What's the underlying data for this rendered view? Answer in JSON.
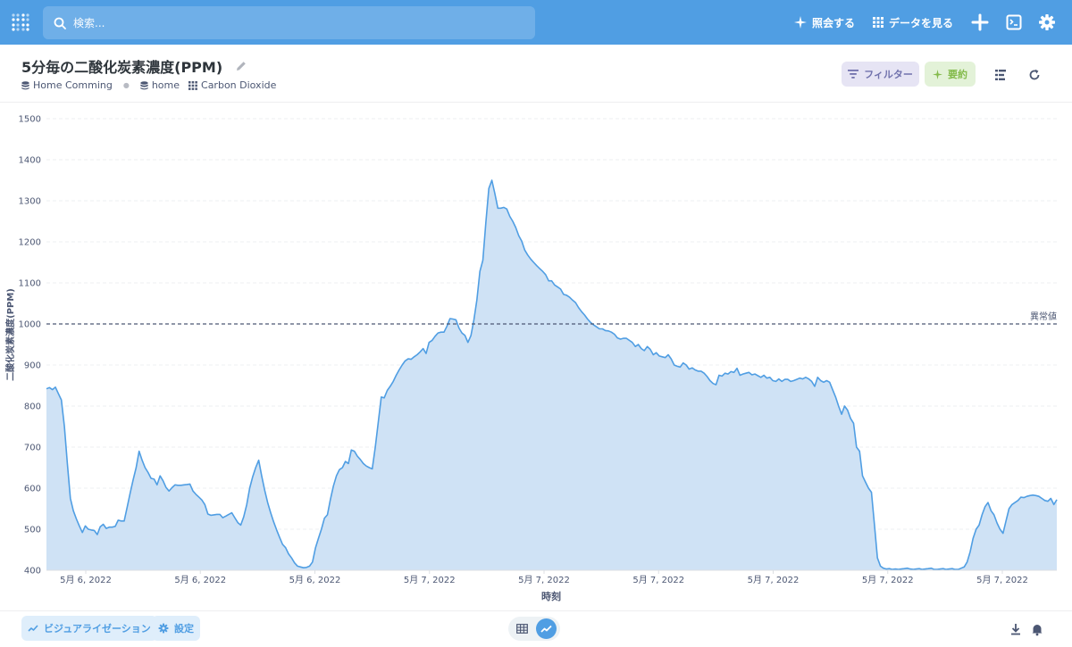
{
  "topbar": {
    "search_placeholder": "検索...",
    "new_question": "照会する",
    "browse_data": "データを見る",
    "icons": [
      "plus-icon",
      "sql-editor-icon",
      "gear-icon"
    ]
  },
  "header": {
    "title": "5分毎の二酸化炭素濃度(PPM)",
    "breadcrumb": [
      "Home Comming",
      "home",
      "Carbon Dioxide"
    ],
    "filter_label": "フィルター",
    "summarize_label": "要約"
  },
  "footer": {
    "visualization_label": "ビジュアライゼーション",
    "settings_label": "設定"
  },
  "colors": {
    "accent": "#509ee3",
    "line": "#509ee3",
    "area": "#cfe2f5",
    "filter": "#7172ad",
    "summarize": "#84bb4c"
  },
  "chart_data": {
    "type": "area",
    "xlabel": "時刻",
    "ylabel": "二酸化炭素濃度(PPM)",
    "ylim": [
      400,
      1500
    ],
    "yticks": [
      400,
      500,
      600,
      700,
      800,
      900,
      1000,
      1100,
      1200,
      1300,
      1400,
      1500
    ],
    "xtick_labels": [
      "5月 6, 2022",
      "5月 6, 2022",
      "5月 6, 2022",
      "5月 7, 2022",
      "5月 7, 2022",
      "5月 7, 2022",
      "5月 7, 2022",
      "5月 7, 2022",
      "5月 7, 2022"
    ],
    "goal": {
      "value": 1000,
      "label": "異常値"
    },
    "grid": true,
    "values": [
      842,
      845,
      840,
      846,
      830,
      815,
      750,
      660,
      575,
      545,
      525,
      508,
      492,
      508,
      500,
      498,
      497,
      487,
      506,
      512,
      502,
      505,
      505,
      507,
      522,
      520,
      520,
      553,
      588,
      620,
      650,
      690,
      668,
      650,
      638,
      624,
      622,
      608,
      630,
      618,
      602,
      593,
      601,
      608,
      607,
      607,
      608,
      609,
      610,
      593,
      585,
      578,
      571,
      560,
      537,
      534,
      535,
      536,
      536,
      528,
      532,
      536,
      540,
      528,
      516,
      510,
      530,
      560,
      600,
      628,
      650,
      668,
      630,
      595,
      565,
      540,
      518,
      498,
      480,
      463,
      455,
      440,
      430,
      418,
      410,
      408,
      406,
      407,
      410,
      420,
      455,
      478,
      500,
      527,
      535,
      573,
      605,
      630,
      645,
      650,
      665,
      660,
      693,
      690,
      678,
      670,
      660,
      654,
      650,
      647,
      700,
      760,
      822,
      820,
      838,
      848,
      860,
      875,
      888,
      900,
      910,
      915,
      914,
      920,
      925,
      932,
      940,
      928,
      955,
      960,
      970,
      978,
      980,
      980,
      995,
      1013,
      1012,
      1010,
      990,
      978,
      972,
      955,
      972,
      1010,
      1058,
      1128,
      1155,
      1248,
      1330,
      1350,
      1318,
      1282,
      1282,
      1284,
      1280,
      1262,
      1250,
      1235,
      1215,
      1202,
      1180,
      1168,
      1158,
      1150,
      1142,
      1135,
      1128,
      1120,
      1105,
      1105,
      1095,
      1090,
      1085,
      1072,
      1070,
      1065,
      1058,
      1052,
      1040,
      1030,
      1022,
      1012,
      1004,
      998,
      993,
      988,
      988,
      984,
      983,
      980,
      975,
      966,
      963,
      965,
      965,
      960,
      955,
      945,
      950,
      940,
      935,
      945,
      938,
      925,
      930,
      922,
      920,
      918,
      925,
      915,
      900,
      897,
      895,
      905,
      900,
      890,
      893,
      888,
      885,
      885,
      880,
      872,
      862,
      855,
      852,
      875,
      873,
      880,
      878,
      884,
      882,
      892,
      875,
      878,
      880,
      882,
      876,
      878,
      874,
      870,
      875,
      868,
      870,
      862,
      860,
      866,
      860,
      865,
      865,
      860,
      862,
      865,
      868,
      866,
      870,
      866,
      860,
      848,
      870,
      862,
      858,
      862,
      858,
      840,
      822,
      800,
      780,
      800,
      790,
      770,
      758,
      700,
      690,
      630,
      615,
      600,
      590,
      510,
      430,
      410,
      405,
      403,
      404,
      402,
      403,
      402,
      403,
      404,
      405,
      403,
      402,
      403,
      404,
      402,
      403,
      404,
      405,
      402,
      402,
      403,
      404,
      402,
      403,
      404,
      402,
      402,
      405,
      408,
      420,
      445,
      478,
      500,
      510,
      535,
      555,
      565,
      545,
      535,
      515,
      500,
      490,
      520,
      550,
      560,
      565,
      570,
      578,
      577,
      580,
      582,
      583,
      582,
      580,
      575,
      570,
      568,
      575,
      560,
      572
    ]
  }
}
